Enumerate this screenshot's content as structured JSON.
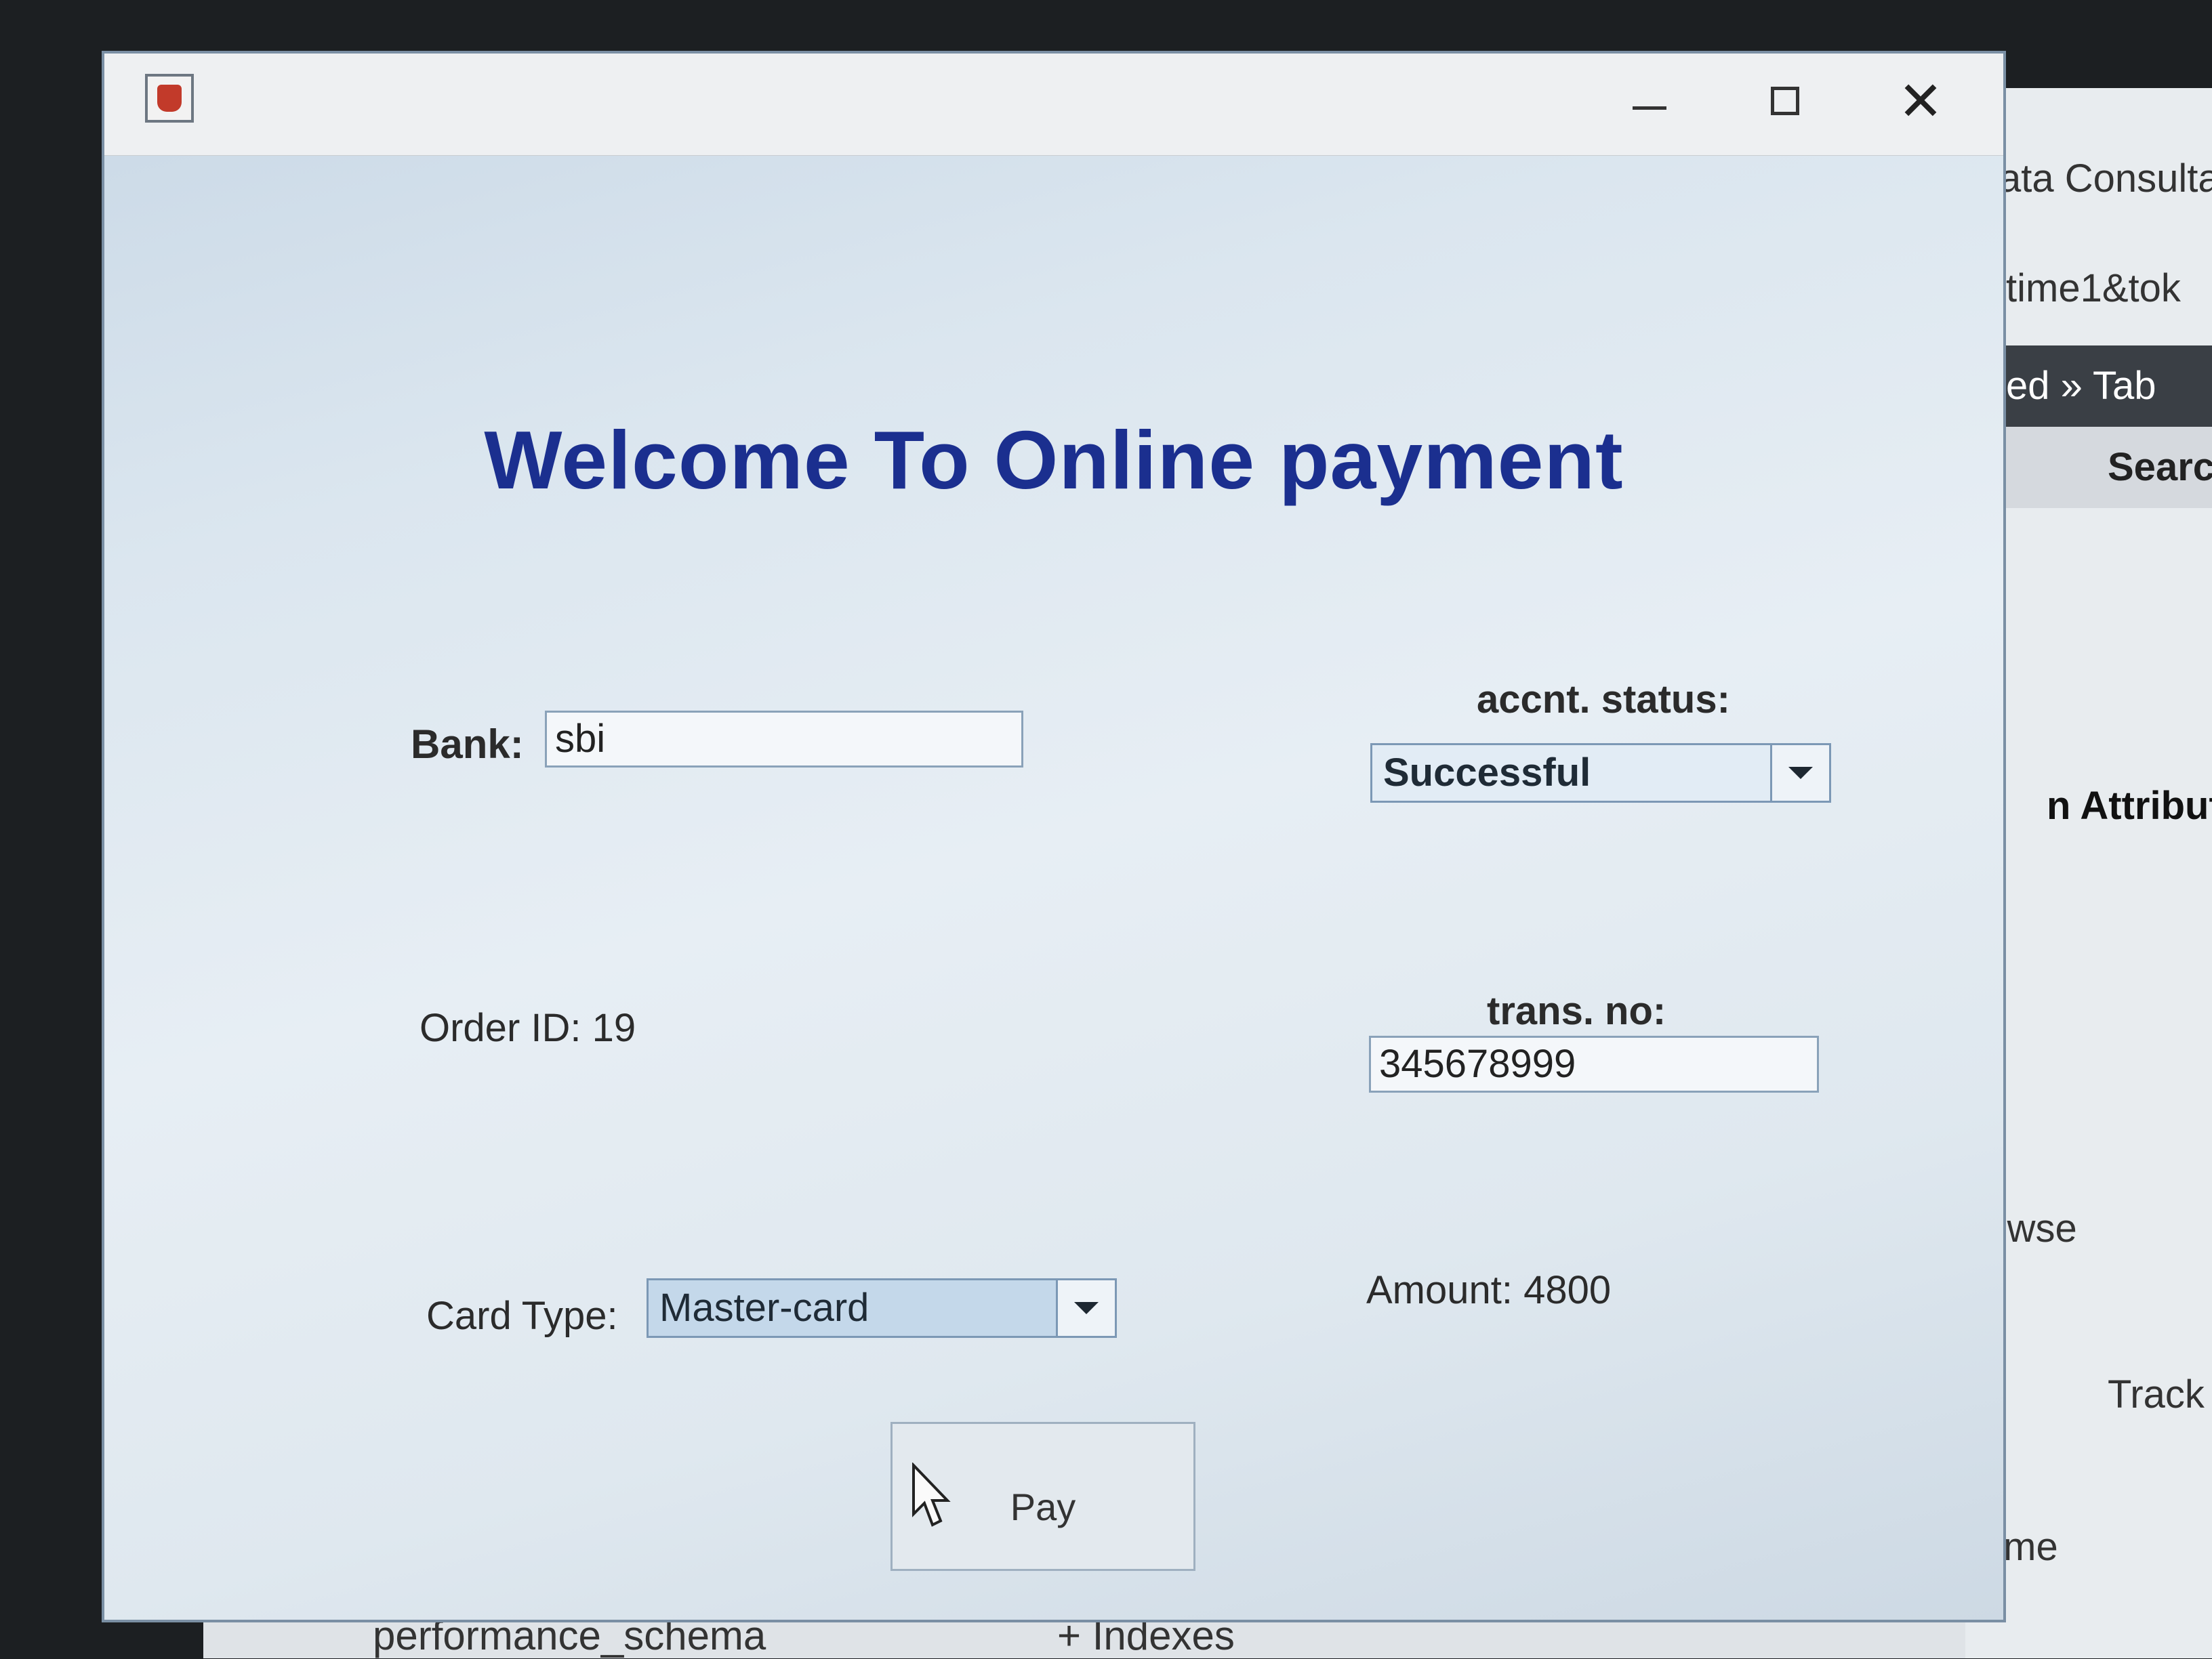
{
  "background_app": {
    "rows": [
      "ata Consulta",
      "time1&tok",
      "ed » Tab",
      "Searc",
      "n  Attribute",
      "rowse",
      "Track",
      "Time"
    ],
    "bottom": [
      "performance_schema",
      "+ Indexes"
    ]
  },
  "window": {
    "controls": {
      "minimize": "—",
      "maximize": "☐",
      "close": "✕"
    }
  },
  "title": "Welcome To Online payment",
  "form": {
    "bank_label": "Bank:",
    "bank_value": "sbi",
    "status_label": "accnt. status:",
    "status_value": "Successful",
    "order_label": "Order ID: 19",
    "trans_label": "trans. no:",
    "trans_value": "345678999",
    "card_label": "Card Type:",
    "card_value": "Master-card",
    "amount_label": "Amount: 4800"
  },
  "pay_button": "Pay",
  "icons": {
    "app": "java-icon",
    "dropdown": "chevron-down-icon",
    "cursor": "cursor-icon"
  }
}
